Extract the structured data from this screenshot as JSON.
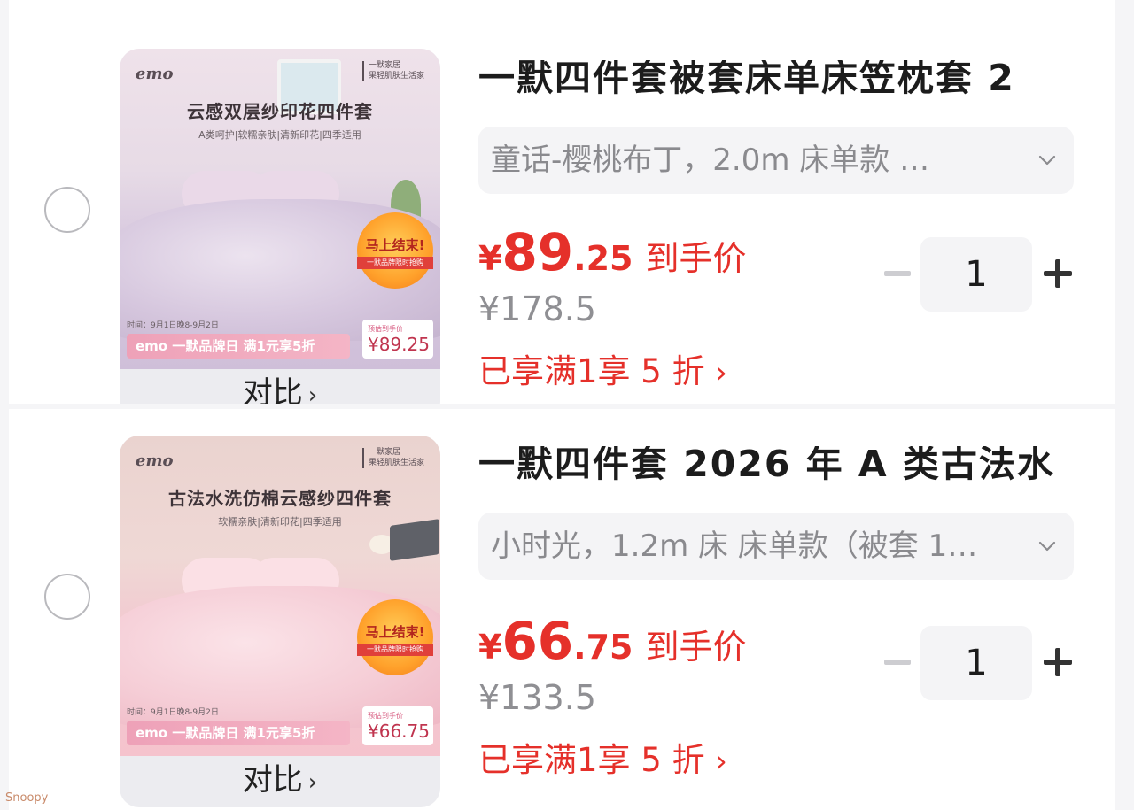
{
  "products": [
    {
      "title": "一默四件套被套床单床笠枕套 2",
      "variant": "童话-樱桃布丁，2.0m 床单款 …",
      "price_currency": "¥",
      "price_integer": "89",
      "price_decimal": ".25",
      "price_suffix": "到手价",
      "original_price": "¥178.5",
      "discount_text": "已享满1享 5 折",
      "quantity": "1",
      "compare_label": "对比",
      "image": {
        "logo": "emo",
        "brand": "一默家居\n果轻肌肤生活家",
        "title": "云感双层纱印花四件套",
        "subtitle": "A类呵护|软糯亲肤|清新印花|四季适用",
        "promo_main": "马上结束!",
        "promo_sub": "一默品牌限时抢购",
        "time_text": "时间：9月1日晚8-9月2日",
        "banner_text": "emo 一默品牌日 满1元享5折",
        "tag_label": "预估到手价",
        "tag_value": "¥89.25"
      }
    },
    {
      "title": "一默四件套 2026 年 A 类古法水",
      "variant": "小时光，1.2m 床 床单款（被套 1…",
      "price_currency": "¥",
      "price_integer": "66",
      "price_decimal": ".75",
      "price_suffix": "到手价",
      "original_price": "¥133.5",
      "discount_text": "已享满1享 5 折",
      "quantity": "1",
      "compare_label": "对比",
      "image": {
        "logo": "emo",
        "brand": "一默家居\n果轻肌肤生活家",
        "title": "古法水洗仿棉云感纱四件套",
        "subtitle": "软糯亲肤|清新印花|四季适用",
        "promo_main": "马上结束!",
        "promo_sub": "一默品牌限时抢购",
        "time_text": "时间：9月1日晚8-9月2日",
        "banner_text": "emo 一默品牌日 满1元享5折",
        "tag_label": "预估到手价",
        "tag_value": "¥66.75"
      }
    }
  ],
  "colors": {
    "price_red": "#e5302a",
    "muted_gray": "#8a8a8e",
    "background": "#f5f5f7"
  },
  "watermark": "Snoopy"
}
